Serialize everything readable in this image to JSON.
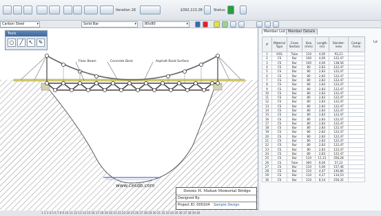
{
  "toolbar": {
    "iteration_label": "Iteration 26",
    "cost_label": "$392,113.28",
    "status_label": "Status:"
  },
  "selectors": {
    "material": "Carbon Steel",
    "cross_section": "Solid Bar",
    "size": "80x80"
  },
  "tools_palette": {
    "title": "Tools"
  },
  "drawing": {
    "labels": {
      "floor_beam": "Floor Beam",
      "concrete_deck": "Concrete Deck",
      "asphalt_surface": "Asphalt Road Surface"
    },
    "website": "www.cesdb.com"
  },
  "title_block": {
    "bridge_name": "Dennis H. Mahan Memorial Bridge",
    "designed_by_label": "Designed By:",
    "project_id_label": "Project ID: 000104",
    "project_name": "Sample Design"
  },
  "panel": {
    "tabs": [
      "Member List",
      "Member Details"
    ],
    "partial_header": "Le",
    "columns": [
      "#",
      "Material Type",
      "Cross Section",
      "Size (mm)",
      "Length (m)",
      "Slender-ness",
      "Compr. Force"
    ],
    "rows": [
      [
        "1",
        "HSS",
        "Tube",
        "110",
        "4,00",
        "93,21"
      ],
      [
        "2",
        "CS",
        "Bar",
        "100",
        "4,00",
        "122,47"
      ],
      [
        "3",
        "CS",
        "Bar",
        "100",
        "4,00",
        "138,56"
      ],
      [
        "4",
        "CS",
        "Bar",
        "80",
        "2,83",
        "122,47"
      ],
      [
        "5",
        "CS",
        "Bar",
        "80",
        "2,83",
        "122,47"
      ],
      [
        "6",
        "CS",
        "Bar",
        "80",
        "2,83",
        "122,47"
      ],
      [
        "7",
        "CS",
        "Bar",
        "80",
        "2,83",
        "122,47"
      ],
      [
        "8",
        "CS",
        "Bar",
        "80",
        "2,83",
        "122,47"
      ],
      [
        "9",
        "CS",
        "Bar",
        "80",
        "2,83",
        "122,47"
      ],
      [
        "10",
        "CS",
        "Bar",
        "80",
        "2,83",
        "122,47"
      ],
      [
        "11",
        "CS",
        "Bar",
        "80",
        "2,83",
        "122,47"
      ],
      [
        "12",
        "CS",
        "Bar",
        "80",
        "2,83",
        "122,47"
      ],
      [
        "13",
        "CS",
        "Bar",
        "80",
        "2,83",
        "122,47"
      ],
      [
        "14",
        "CS",
        "Bar",
        "80",
        "2,83",
        "122,47"
      ],
      [
        "15",
        "CS",
        "Bar",
        "80",
        "2,83",
        "122,47"
      ],
      [
        "16",
        "CS",
        "Bar",
        "80",
        "2,83",
        "122,47"
      ],
      [
        "17",
        "CS",
        "Bar",
        "80",
        "2,83",
        "122,47"
      ],
      [
        "18",
        "CS",
        "Bar",
        "80",
        "2,83",
        "122,47"
      ],
      [
        "19",
        "CS",
        "Bar",
        "80",
        "2,83",
        "122,47"
      ],
      [
        "20",
        "CS",
        "Bar",
        "80",
        "2,83",
        "122,47"
      ],
      [
        "21",
        "CS",
        "Bar",
        "80",
        "2,83",
        "122,47"
      ],
      [
        "22",
        "CS",
        "Bar",
        "80",
        "2,83",
        "122,47"
      ],
      [
        "23",
        "CS",
        "Bar",
        "80",
        "2,83",
        "122,47"
      ],
      [
        "24",
        "CS",
        "Bar",
        "80",
        "2,83",
        "122,47"
      ],
      [
        "25",
        "CS",
        "Bar",
        "110",
        "11,31",
        "356,28"
      ],
      [
        "26",
        "CS",
        "Tube",
        "360",
        "8,00",
        "57,22"
      ],
      [
        "27",
        "CS",
        "Bar",
        "110",
        "5,00",
        "157,46"
      ],
      [
        "28",
        "CS",
        "Bar",
        "110",
        "4,47",
        "140,84"
      ],
      [
        "29",
        "CS",
        "Bar",
        "110",
        "4,27",
        "134,53"
      ],
      [
        "30",
        "CS",
        "Bar",
        "110",
        "8,14",
        "256,32"
      ]
    ]
  },
  "statusbar": {
    "text": "1 2 3 4 5 6 7 8 9 10 11 12 13 14 15 16 17 18 19 20 21 22 23 24 25 26 27 28 29 30 31 32 33 34 35 36 37 38 39 40"
  }
}
